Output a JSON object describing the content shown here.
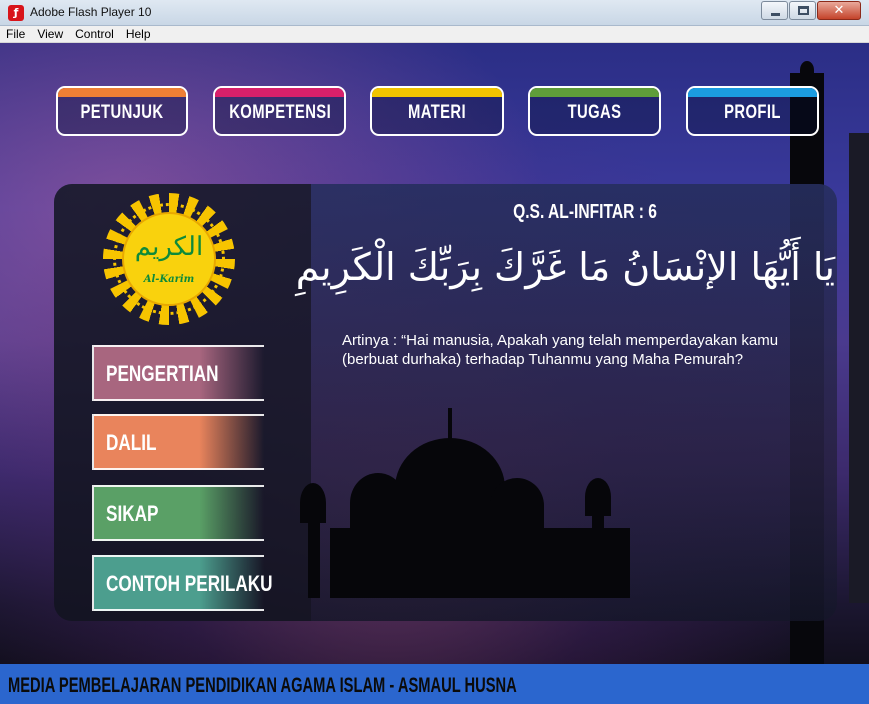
{
  "window": {
    "icon": "flash-player-icon",
    "title": "Adobe Flash Player 10",
    "controls": [
      "minimize-icon",
      "maximize-icon",
      "close-icon"
    ]
  },
  "menu": {
    "items": [
      "File",
      "View",
      "Control",
      "Help"
    ]
  },
  "nav": {
    "buttons": [
      {
        "label": "PETUNJUK",
        "color": "#ef7f35"
      },
      {
        "label": "KOMPETENSI",
        "color": "#d8206a"
      },
      {
        "label": "MATERI",
        "color": "#f2c400"
      },
      {
        "label": "TUGAS",
        "color": "#5f9e3a"
      },
      {
        "label": "PROFIL",
        "color": "#1b9ce0"
      }
    ]
  },
  "logo": {
    "arabic": "الكريم",
    "latin": "Al-Karim",
    "color": "#f7c400"
  },
  "side_menu": {
    "items": [
      {
        "label": "PENGERTIAN",
        "color": "#a8667f"
      },
      {
        "label": "DALIL",
        "color": "#e9845c"
      },
      {
        "label": "SIKAP",
        "color": "#5aa066"
      },
      {
        "label": "CONTOH PERILAKU",
        "color": "#4c9e8e"
      }
    ]
  },
  "content": {
    "surah": "Q.S. AL-INFITAR : 6",
    "verse": "يَا أَيُّهَا الإنْسَانُ مَا غَرَّكَ بِرَبِّكَ الْكَرِيمِ",
    "translation": "Artinya : “Hai manusia, Apakah yang telah memperdayakan kamu (berbuat durhaka) terhadap Tuhanmu yang Maha Pemurah?"
  },
  "footer": {
    "text": "MEDIA PEMBELAJARAN PENDIDIKAN AGAMA ISLAM - ASMAUL HUSNA",
    "color": "#2b66ce"
  }
}
